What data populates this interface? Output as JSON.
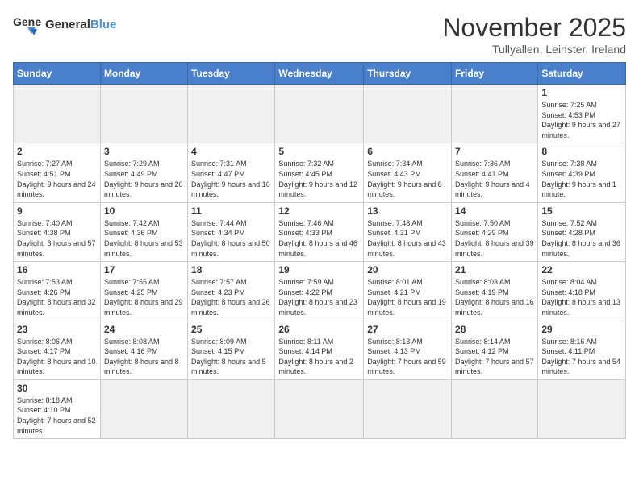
{
  "logo": {
    "text_general": "General",
    "text_blue": "Blue"
  },
  "title": "November 2025",
  "location": "Tullyallen, Leinster, Ireland",
  "weekdays": [
    "Sunday",
    "Monday",
    "Tuesday",
    "Wednesday",
    "Thursday",
    "Friday",
    "Saturday"
  ],
  "weeks": [
    [
      {
        "day": "",
        "empty": true
      },
      {
        "day": "",
        "empty": true
      },
      {
        "day": "",
        "empty": true
      },
      {
        "day": "",
        "empty": true
      },
      {
        "day": "",
        "empty": true
      },
      {
        "day": "",
        "empty": true
      },
      {
        "day": "1",
        "info": "Sunrise: 7:25 AM\nSunset: 4:53 PM\nDaylight: 9 hours\nand 27 minutes."
      }
    ],
    [
      {
        "day": "2",
        "info": "Sunrise: 7:27 AM\nSunset: 4:51 PM\nDaylight: 9 hours\nand 24 minutes."
      },
      {
        "day": "3",
        "info": "Sunrise: 7:29 AM\nSunset: 4:49 PM\nDaylight: 9 hours\nand 20 minutes."
      },
      {
        "day": "4",
        "info": "Sunrise: 7:31 AM\nSunset: 4:47 PM\nDaylight: 9 hours\nand 16 minutes."
      },
      {
        "day": "5",
        "info": "Sunrise: 7:32 AM\nSunset: 4:45 PM\nDaylight: 9 hours\nand 12 minutes."
      },
      {
        "day": "6",
        "info": "Sunrise: 7:34 AM\nSunset: 4:43 PM\nDaylight: 9 hours\nand 8 minutes."
      },
      {
        "day": "7",
        "info": "Sunrise: 7:36 AM\nSunset: 4:41 PM\nDaylight: 9 hours\nand 4 minutes."
      },
      {
        "day": "8",
        "info": "Sunrise: 7:38 AM\nSunset: 4:39 PM\nDaylight: 9 hours\nand 1 minute."
      }
    ],
    [
      {
        "day": "9",
        "info": "Sunrise: 7:40 AM\nSunset: 4:38 PM\nDaylight: 8 hours\nand 57 minutes."
      },
      {
        "day": "10",
        "info": "Sunrise: 7:42 AM\nSunset: 4:36 PM\nDaylight: 8 hours\nand 53 minutes."
      },
      {
        "day": "11",
        "info": "Sunrise: 7:44 AM\nSunset: 4:34 PM\nDaylight: 8 hours\nand 50 minutes."
      },
      {
        "day": "12",
        "info": "Sunrise: 7:46 AM\nSunset: 4:33 PM\nDaylight: 8 hours\nand 46 minutes."
      },
      {
        "day": "13",
        "info": "Sunrise: 7:48 AM\nSunset: 4:31 PM\nDaylight: 8 hours\nand 43 minutes."
      },
      {
        "day": "14",
        "info": "Sunrise: 7:50 AM\nSunset: 4:29 PM\nDaylight: 8 hours\nand 39 minutes."
      },
      {
        "day": "15",
        "info": "Sunrise: 7:52 AM\nSunset: 4:28 PM\nDaylight: 8 hours\nand 36 minutes."
      }
    ],
    [
      {
        "day": "16",
        "info": "Sunrise: 7:53 AM\nSunset: 4:26 PM\nDaylight: 8 hours\nand 32 minutes."
      },
      {
        "day": "17",
        "info": "Sunrise: 7:55 AM\nSunset: 4:25 PM\nDaylight: 8 hours\nand 29 minutes."
      },
      {
        "day": "18",
        "info": "Sunrise: 7:57 AM\nSunset: 4:23 PM\nDaylight: 8 hours\nand 26 minutes."
      },
      {
        "day": "19",
        "info": "Sunrise: 7:59 AM\nSunset: 4:22 PM\nDaylight: 8 hours\nand 23 minutes."
      },
      {
        "day": "20",
        "info": "Sunrise: 8:01 AM\nSunset: 4:21 PM\nDaylight: 8 hours\nand 19 minutes."
      },
      {
        "day": "21",
        "info": "Sunrise: 8:03 AM\nSunset: 4:19 PM\nDaylight: 8 hours\nand 16 minutes."
      },
      {
        "day": "22",
        "info": "Sunrise: 8:04 AM\nSunset: 4:18 PM\nDaylight: 8 hours\nand 13 minutes."
      }
    ],
    [
      {
        "day": "23",
        "info": "Sunrise: 8:06 AM\nSunset: 4:17 PM\nDaylight: 8 hours\nand 10 minutes."
      },
      {
        "day": "24",
        "info": "Sunrise: 8:08 AM\nSunset: 4:16 PM\nDaylight: 8 hours\nand 8 minutes."
      },
      {
        "day": "25",
        "info": "Sunrise: 8:09 AM\nSunset: 4:15 PM\nDaylight: 8 hours\nand 5 minutes."
      },
      {
        "day": "26",
        "info": "Sunrise: 8:11 AM\nSunset: 4:14 PM\nDaylight: 8 hours\nand 2 minutes."
      },
      {
        "day": "27",
        "info": "Sunrise: 8:13 AM\nSunset: 4:13 PM\nDaylight: 7 hours\nand 59 minutes."
      },
      {
        "day": "28",
        "info": "Sunrise: 8:14 AM\nSunset: 4:12 PM\nDaylight: 7 hours\nand 57 minutes."
      },
      {
        "day": "29",
        "info": "Sunrise: 8:16 AM\nSunset: 4:11 PM\nDaylight: 7 hours\nand 54 minutes."
      }
    ],
    [
      {
        "day": "30",
        "info": "Sunrise: 8:18 AM\nSunset: 4:10 PM\nDaylight: 7 hours\nand 52 minutes."
      },
      {
        "day": "",
        "empty": true
      },
      {
        "day": "",
        "empty": true
      },
      {
        "day": "",
        "empty": true
      },
      {
        "day": "",
        "empty": true
      },
      {
        "day": "",
        "empty": true
      },
      {
        "day": "",
        "empty": true
      }
    ]
  ]
}
